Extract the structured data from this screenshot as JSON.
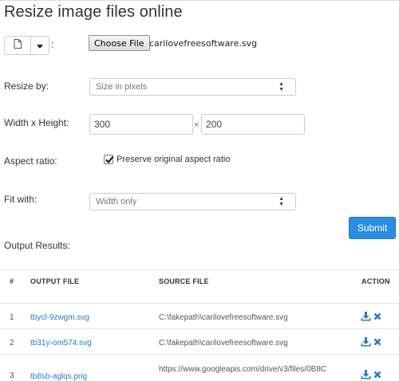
{
  "page": {
    "title": "Resize image files online"
  },
  "upload": {
    "colon": ":",
    "choose_button": "Choose File",
    "file_name": "carilovefreesoftware.svg"
  },
  "form": {
    "resize_by": {
      "label": "Resize by:",
      "value": "Size in pixels"
    },
    "dimensions": {
      "label": "Width x Height:",
      "width": "300",
      "separator": "×",
      "height": "200"
    },
    "aspect_ratio": {
      "label": "Aspect ratio:",
      "checkbox_label": "Preserve original aspect ratio",
      "checked": true
    },
    "fit_with": {
      "label": "Fit with:",
      "value": "Width only"
    },
    "submit_label": "Submit"
  },
  "results": {
    "title": "Output Results:",
    "columns": [
      "#",
      "OUTPUT FILE",
      "SOURCE FILE",
      "ACTION"
    ],
    "rows": [
      {
        "num": "1",
        "output": "tbycl-9zwgm.svg",
        "source": "C:\\fakepath\\carilovefreesoftware.svg"
      },
      {
        "num": "2",
        "output": "tb31y-om574.svg",
        "source": "C:\\fakepath\\carilovefreesoftware.svg"
      },
      {
        "num": "3",
        "output": "tb8sb-aglqs.png",
        "source": "https://www.googleapis.com/drive/v3/files/0B8C"
      }
    ]
  },
  "icons": {
    "file": "file-icon",
    "caret": "caret-down-icon",
    "download": "download-icon",
    "delete": "delete-icon"
  },
  "colors": {
    "link": "#2a7bc6",
    "submit": "#2a8ee0",
    "action_icon": "#2a7bc6"
  }
}
